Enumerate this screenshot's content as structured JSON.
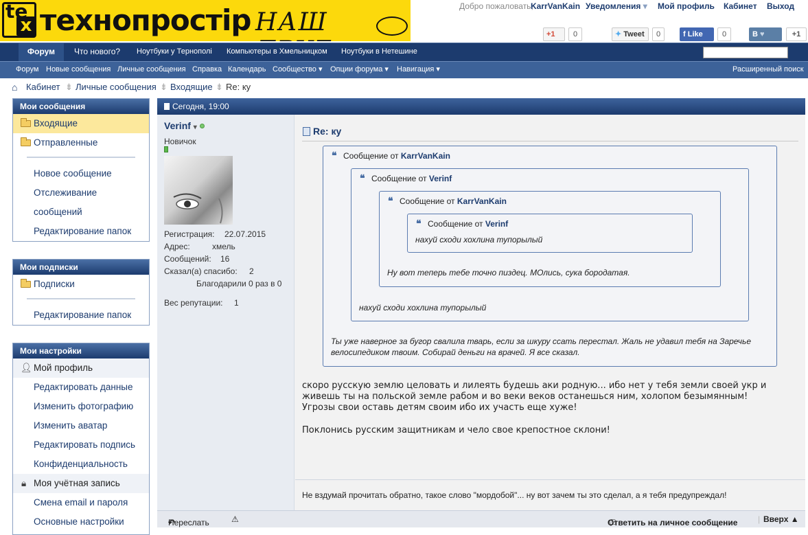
{
  "logo": {
    "mark1": "te",
    "mark2": "x",
    "brand": "технопростір",
    "tagline": "НАШ ДРУГ"
  },
  "userbar": {
    "welcome": "Добро пожаловать,",
    "username": "KarrVanKain",
    "notifications": "Уведомления",
    "profile": "Мой профиль",
    "cabinet": "Кабинет",
    "logout": "Выход"
  },
  "social": {
    "gplus": "+1",
    "gplus_count": "0",
    "tweet": "Tweet",
    "tweet_count": "0",
    "like": "Like",
    "like_count": "0",
    "vk": "В",
    "vk_plus": "+1"
  },
  "nav": {
    "tabs": [
      "Форум",
      "Что нового?",
      "Ноутбуки у Тернополі",
      "Компьютеры в Хмельницком",
      "Ноутбуки в Нетешине"
    ]
  },
  "subnav": {
    "items": [
      "Форум",
      "Новые сообщения",
      "Личные сообщения",
      "Справка",
      "Календарь",
      "Сообщество ▾",
      "Опции форума ▾",
      "Навигация ▾"
    ],
    "advanced_search": "Расширенный поиск"
  },
  "breadcrumb": {
    "items": [
      "Кабинет",
      "Личные сообщения",
      "Входящие",
      "Re: ку"
    ]
  },
  "sidebar": {
    "messages": {
      "title": "Мои сообщения",
      "items": [
        "Входящие",
        "Отправленные",
        "Новое сообщение",
        "Отслеживание",
        "сообщений",
        "Редактирование папок"
      ]
    },
    "subscriptions": {
      "title": "Мои подписки",
      "items": [
        "Подписки",
        "Редактирование папок"
      ]
    },
    "settings": {
      "title": "Мои настройки",
      "items": [
        "Мой профиль",
        "Редактировать данные",
        "Изменить фотографию",
        "Изменить аватар",
        "Редактировать подпись",
        "Конфиденциальность",
        "Моя учётная запись",
        "Смена email и пароля",
        "Основные настройки"
      ]
    }
  },
  "post": {
    "date": "Сегодня, 19:00",
    "user": {
      "name": "Verinf",
      "rank": "Новичок",
      "reg_label": "Регистрация:",
      "reg_value": "22.07.2015",
      "addr_label": "Адрес:",
      "addr_value": "хмель",
      "msgs_label": "Сообщений:",
      "msgs_value": "16",
      "thanks_label": "Сказал(а) спасибо:",
      "thanks_value": "2",
      "thanked": "Благодарили 0 раз в 0",
      "rep_label": "Вес репутации:",
      "rep_value": "1"
    },
    "title": "Re: ку",
    "quote_prefix": "Сообщение от",
    "q1_author": "KarrVanKain",
    "q2_author": "Verinf",
    "q3_author": "KarrVanKain",
    "q4_author": "Verinf",
    "q4_text": "нахуй сходи хохлина тупорылый",
    "q3_text": "Ну вот теперь тебе точно пиздец. МОлись, сука бородатая.",
    "q2_text": "нахуй сходи хохлина тупорылый",
    "q1_text": "Ты уже наверное за бугор свалила тварь, если за шкуру ссать перестал. Жаль не удавил тебя на Заречье велосипедиком твоим. Собирай деньги на врачей. Я все сказал.",
    "body1": "скоро русскую землю целовать и лилеять будешь аки родную... ибо нет у тебя земли своей укр и живешь ты на польской земле рабом и во веки веков останешься ним, холопом безымянным! Угрозы свои оставь детям своим ибо их участь еще хуже!",
    "body2": "Поклонись русским защитникам и чело свое крепостное склони!",
    "signature": "Не вздумай прочитать обратно, такое слово \"мордобой\"... ну вот зачем ты это сделал, а я тебя предупреждал!",
    "forward": "Переслать",
    "reply": "Ответить на личное сообщение",
    "up": "Вверх ▲"
  }
}
